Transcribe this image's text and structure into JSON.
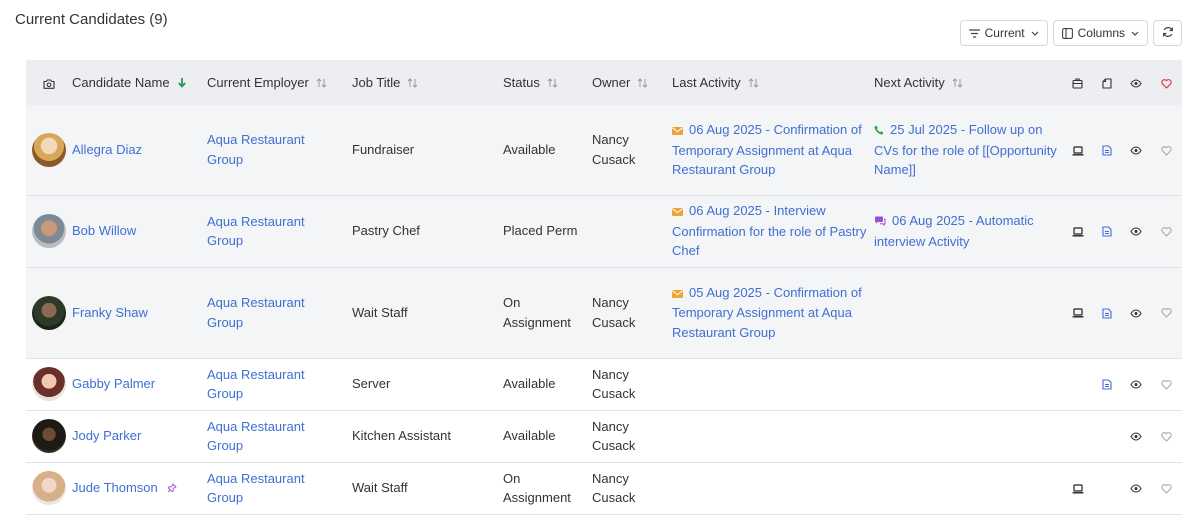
{
  "page": {
    "title": "Current Candidates (9)"
  },
  "toolbar": {
    "filter_label": "Current",
    "columns_label": "Columns"
  },
  "colors": {
    "link": "#3f6fd1",
    "email": "#f0a23a",
    "phone": "#2eaa5a",
    "chat": "#9c4fd6",
    "heart": "#e0394b",
    "sort_active": "#1f9d55"
  },
  "columns": {
    "name": "Candidate Name",
    "employer": "Current Employer",
    "job": "Job Title",
    "status": "Status",
    "owner": "Owner",
    "last": "Last Activity",
    "next": "Next Activity"
  },
  "rows": [
    {
      "name": "Allegra Diaz",
      "employer": "Aqua Restaurant Group",
      "job": "Fundraiser",
      "status": "Available",
      "owner": "Nancy Cusack",
      "last_icon": "email-icon",
      "last": "06 Aug 2025 - Confirmation of Temporary Assignment at Aqua Restaurant Group",
      "next_icon": "phone-icon",
      "next": "25 Jul 2025 - Follow up on CVs for the role of [[Opportunity Name]]",
      "icons": [
        "laptop-icon",
        "document-icon",
        "eye-icon",
        "heart-icon"
      ]
    },
    {
      "name": "Bob Willow",
      "employer": "Aqua Restaurant Group",
      "job": "Pastry Chef",
      "status": "Placed Perm",
      "owner": "",
      "last_icon": "email-icon",
      "last": "06 Aug 2025 - Interview Confirmation for the role of Pastry Chef",
      "next_icon": "chat-icon",
      "next": "06 Aug 2025 - Automatic interview Activity",
      "icons": [
        "laptop-icon",
        "document-icon",
        "eye-icon",
        "heart-icon"
      ]
    },
    {
      "name": "Franky Shaw",
      "employer": "Aqua Restaurant Group",
      "job": "Wait Staff",
      "status": "On Assignment",
      "owner": "Nancy Cusack",
      "last_icon": "email-icon",
      "last": "05 Aug 2025 - Confirmation of Temporary Assignment at Aqua Restaurant Group",
      "next_icon": "",
      "next": "",
      "icons": [
        "laptop-icon",
        "document-icon",
        "eye-icon",
        "heart-icon"
      ]
    },
    {
      "name": "Gabby Palmer",
      "employer": "Aqua Restaurant Group",
      "job": "Server",
      "status": "Available",
      "owner": "Nancy Cusack",
      "last_icon": "",
      "last": "",
      "next_icon": "",
      "next": "",
      "icons": [
        "",
        "document-icon",
        "eye-icon",
        "heart-icon"
      ]
    },
    {
      "name": "Jody Parker",
      "employer": "Aqua Restaurant Group",
      "job": "Kitchen Assistant",
      "status": "Available",
      "owner": "Nancy Cusack",
      "last_icon": "",
      "last": "",
      "next_icon": "",
      "next": "",
      "icons": [
        "",
        "",
        "eye-icon",
        "heart-icon"
      ]
    },
    {
      "name": "Jude Thomson",
      "name_icon": "pin-icon",
      "employer": "Aqua Restaurant Group",
      "job": "Wait Staff",
      "status": "On Assignment",
      "owner": "Nancy Cusack",
      "last_icon": "",
      "last": "",
      "next_icon": "",
      "next": "",
      "icons": [
        "laptop-icon",
        "",
        "eye-icon",
        "heart-icon"
      ]
    }
  ]
}
